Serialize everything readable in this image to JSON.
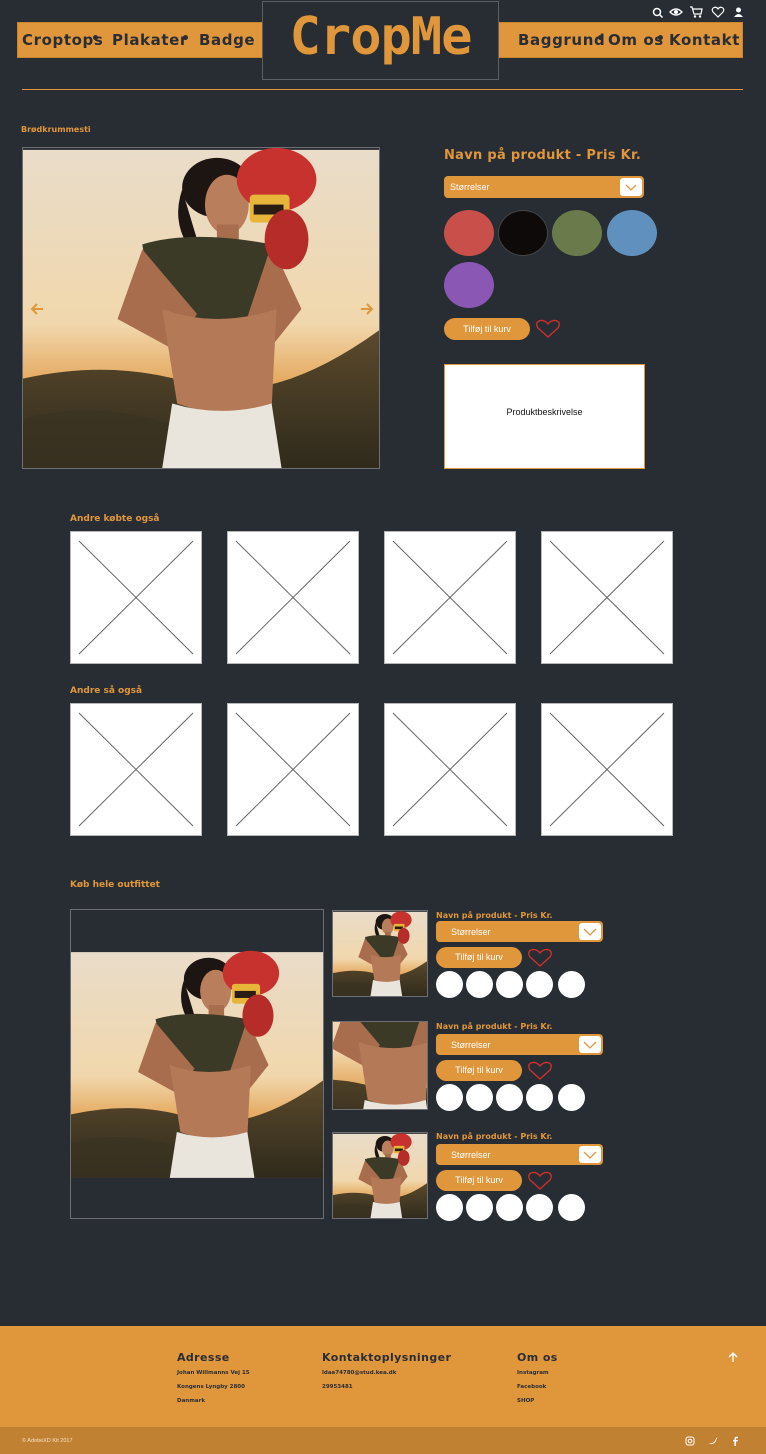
{
  "header": {
    "logo": "CropMe",
    "nav_left": [
      "Croptops",
      "Plakater",
      "Badge"
    ],
    "nav_right": [
      "Baggrund",
      "Om os",
      "Kontakt"
    ],
    "icons": [
      "search-icon",
      "eye-icon",
      "cart-icon",
      "heart-icon",
      "user-icon"
    ]
  },
  "breadcrumb": "Brødkrummesti",
  "product": {
    "title": "Navn på produkt - Pris Kr.",
    "size_select": "Størrelser",
    "colors": [
      "#c94f4a",
      "#0e0a0a",
      "#6b7a4b",
      "#5f90be",
      "#8a58b4"
    ],
    "add_to_cart": "Tilføj til kurv",
    "description": "Produktbeskrivelse"
  },
  "sections": {
    "bought": "Andre købte også",
    "seen": "Andre så også",
    "outfit": "Køb hele outfittet"
  },
  "outfit_items": [
    {
      "title": "Navn på produkt - Pris Kr.",
      "size": "Størrelser",
      "cart": "Tilføj til kurv"
    },
    {
      "title": "Navn på produkt - Pris Kr.",
      "size": "Størrelser",
      "cart": "Tilføj til kurv"
    },
    {
      "title": "Navn på produkt - Pris Kr.",
      "size": "Størrelser",
      "cart": "Tilføj til kurv"
    }
  ],
  "footer": {
    "address_head": "Adresse",
    "address_lines": [
      "Johan Willmanns Vej 15",
      "Kongens Lyngby 2800",
      "Danmark"
    ],
    "contact_head": "Kontaktoplysninger",
    "contact_lines": [
      "ldaa74780@stud.kea.dk",
      "29953481"
    ],
    "about_head": "Om os",
    "about_lines": [
      "Instagram",
      "Facebook",
      "SHOP"
    ],
    "copyright": "© AdobeXD Kit 2017",
    "social_icons": [
      "instagram-icon",
      "twitter-icon",
      "facebook-icon"
    ]
  },
  "colors": {
    "accent": "#e0973c",
    "background": "#282d33"
  }
}
